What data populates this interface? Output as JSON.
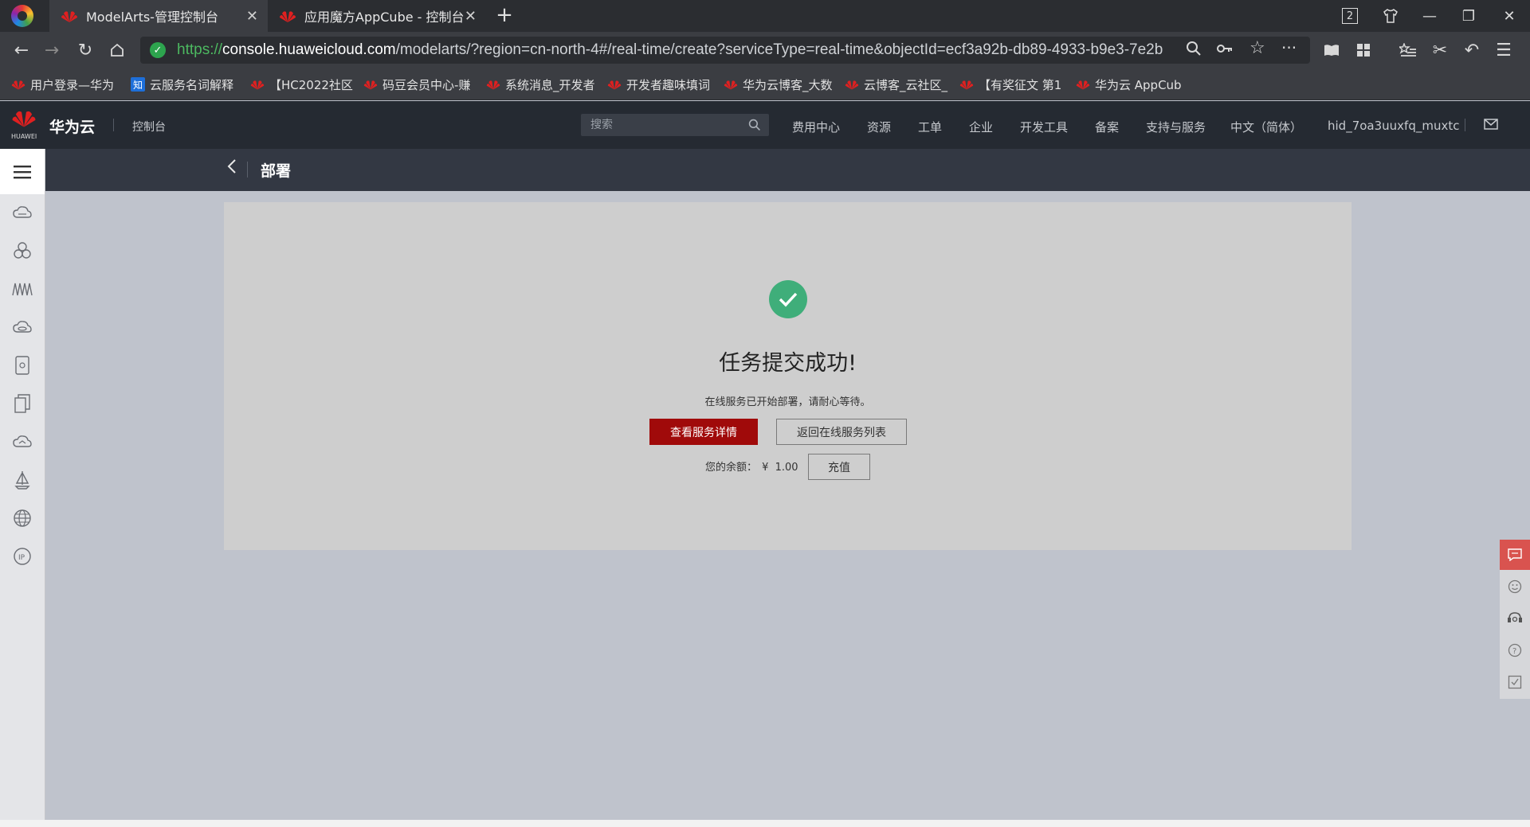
{
  "browser": {
    "tabs": [
      {
        "label": "ModelArts-管理控制台",
        "active": true
      },
      {
        "label": "应用魔方AppCube - 控制台",
        "active": false
      }
    ],
    "new_tab": "+",
    "tab_count_badge": "2",
    "url": {
      "scheme": "https://",
      "host": "console.huaweicloud.com",
      "path": "/modelarts/?region=cn-north-4#/real-time/create?serviceType=real-time&objectId=ecf3a92b-db89-4933-b9e3-7e2b"
    },
    "bookmarks": [
      {
        "label": "用户登录—华为",
        "icon": "huawei-logo"
      },
      {
        "label": "云服务名词解释",
        "icon": "zhihu-logo",
        "icon_text": "知"
      },
      {
        "label": "【HC2022社区",
        "icon": "huawei-logo"
      },
      {
        "label": "码豆会员中心-赚",
        "icon": "huawei-logo"
      },
      {
        "label": "系统消息_开发者",
        "icon": "huawei-logo"
      },
      {
        "label": "开发者趣味填词",
        "icon": "huawei-logo"
      },
      {
        "label": "华为云博客_大数",
        "icon": "huawei-logo"
      },
      {
        "label": "云博客_云社区_",
        "icon": "huawei-logo"
      },
      {
        "label": "【有奖征文 第1",
        "icon": "huawei-logo"
      },
      {
        "label": "华为云 AppCub",
        "icon": "huawei-logo"
      }
    ]
  },
  "console_header": {
    "brand_small": "HUAWEI",
    "brand": "华为云",
    "console_link": "控制台",
    "search_placeholder": "搜索",
    "nav": [
      "费用中心",
      "资源",
      "工单",
      "企业",
      "开发工具",
      "备案",
      "支持与服务",
      "中文（简体）",
      "hid_7oa3uuxfq_muxtc"
    ]
  },
  "sub_header": {
    "title": "部署"
  },
  "result": {
    "title": "任务提交成功!",
    "message": "在线服务已开始部署，请耐心等待。",
    "primary_button": "查看服务详情",
    "secondary_button": "返回在线服务列表",
    "balance_label": "您的余额：",
    "balance_currency": "¥",
    "balance_value": "1.00",
    "recharge_button": "充值"
  },
  "colors": {
    "primary_red": "#a00a0a",
    "success_green": "#3fae7a",
    "header_dark": "#252a32"
  }
}
